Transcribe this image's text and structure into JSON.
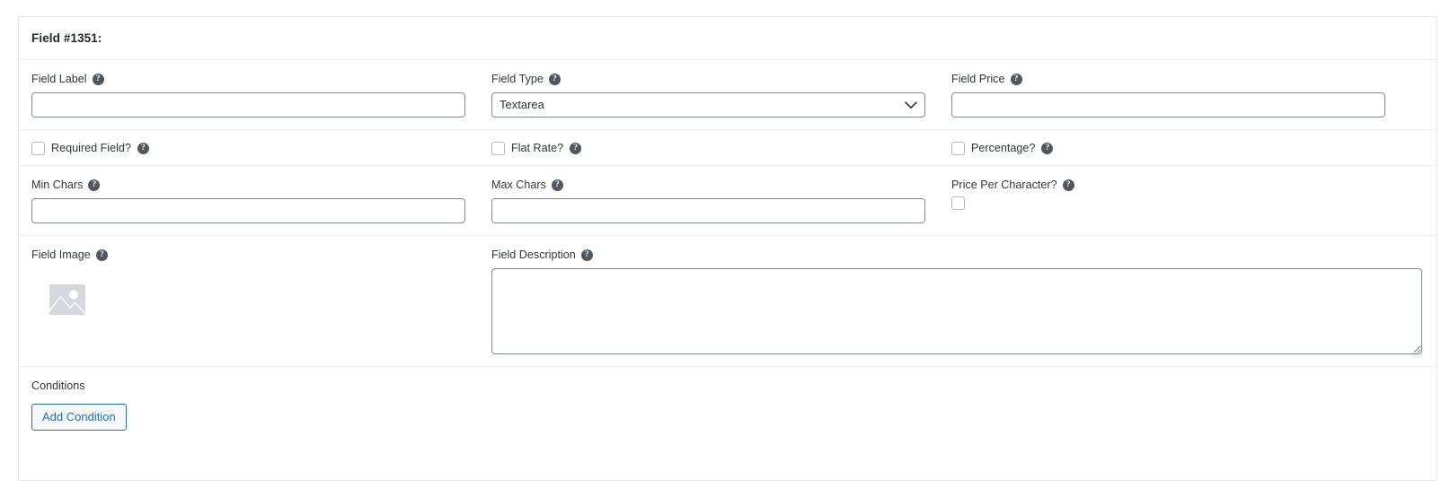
{
  "card": {
    "header_title": "Field #1351:"
  },
  "icons": {
    "help": "?",
    "help_name": "help-circle-icon",
    "chevron": "chevron-down-icon",
    "image_placeholder": "image-placeholder-icon"
  },
  "fields": {
    "field_label": {
      "label": "Field Label",
      "value": "",
      "placeholder": ""
    },
    "field_type": {
      "label": "Field Type",
      "selected": "Textarea",
      "options": [
        "Textarea"
      ]
    },
    "field_price": {
      "label": "Field Price",
      "value": "",
      "placeholder": ""
    },
    "required_field": {
      "label": "Required Field?",
      "checked": false
    },
    "flat_rate": {
      "label": "Flat Rate?",
      "checked": false
    },
    "percentage": {
      "label": "Percentage?",
      "checked": false
    },
    "min_chars": {
      "label": "Min Chars",
      "value": "",
      "placeholder": ""
    },
    "max_chars": {
      "label": "Max Chars",
      "value": "",
      "placeholder": ""
    },
    "price_per_character": {
      "label": "Price Per Character?",
      "checked": false
    },
    "field_image": {
      "label": "Field Image"
    },
    "field_description": {
      "label": "Field Description",
      "value": "",
      "placeholder": ""
    }
  },
  "conditions": {
    "label": "Conditions",
    "add_button": "Add Condition"
  },
  "colors": {
    "accent_blue": "#2271b1",
    "border_input": "#7e8993",
    "border_card": "#e6e6e8",
    "divider": "#eceef0",
    "text": "#32373c",
    "help_bg": "#50575e",
    "image_placeholder": "#d5d8dc"
  }
}
